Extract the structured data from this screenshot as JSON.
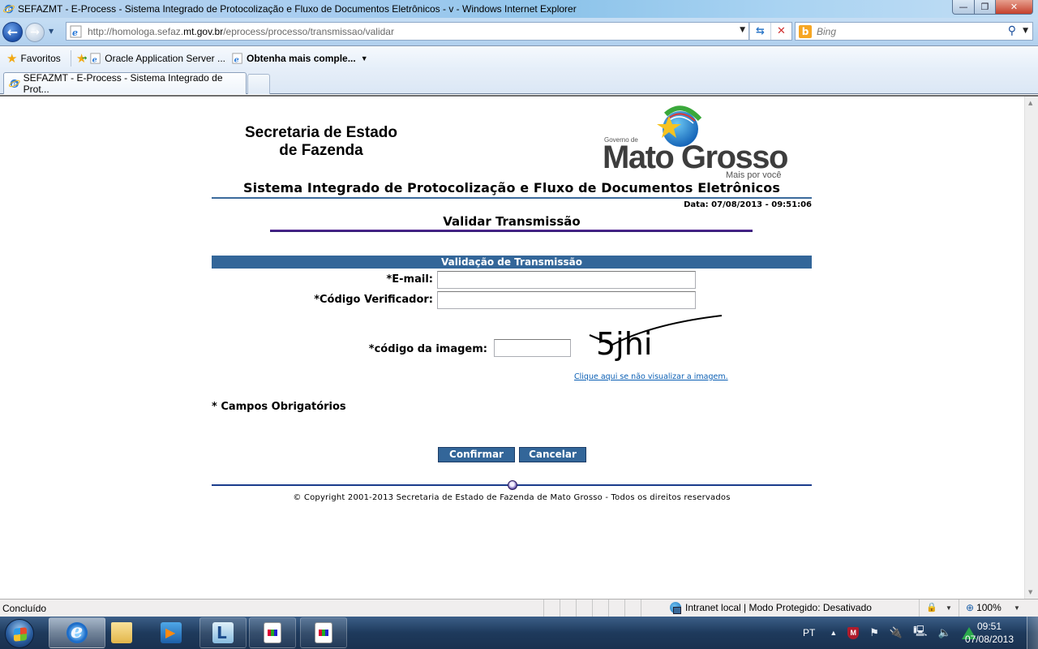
{
  "window": {
    "title": "SEFAZMT - E-Process - Sistema Integrado de Protocolização e Fluxo de Documentos Eletrônicos - v - Windows Internet Explorer",
    "minimize": "—",
    "maximize": "❐",
    "close": "✕"
  },
  "address_bar": {
    "url_prefix": "http://homologa.sefaz.",
    "url_domain": "mt.gov.br",
    "url_path": "/eprocess/processo/transmissao/validar",
    "dropdown": "▼",
    "refresh": "⇆",
    "stop": "✕"
  },
  "search": {
    "placeholder": "Bing",
    "provider_logo": "b",
    "search_glyph": "⚲",
    "dropdown": "▼"
  },
  "favorites_bar": {
    "favorites_label": "Favoritos",
    "items": [
      {
        "label": "Oracle Application Server ..."
      },
      {
        "label": "Obtenha mais comple..."
      }
    ],
    "dropdown": "▼"
  },
  "tabs": [
    {
      "label": "SEFAZMT - E-Process - Sistema Integrado de Prot...",
      "active": true
    }
  ],
  "header": {
    "org_line1": "Secretaria de Estado",
    "org_line2": "de Fazenda",
    "logo_gov": "Governo de",
    "logo_name": "Mato Grosso",
    "logo_slogan": "Mais por você",
    "system_title": "Sistema Integrado de Protocolização e Fluxo de Documentos Eletrônicos",
    "date": "Data: 07/08/2013 - 09:51:06"
  },
  "page": {
    "title": "Validar Transmissão",
    "section_title": "Validação de Transmissão"
  },
  "form": {
    "email_label": "*E-mail:",
    "email_value": "",
    "code_label": "*Código Verificador:",
    "code_value": "",
    "captcha_label": "*código da imagem:",
    "captcha_value": "",
    "captcha_text": "5jhi",
    "captcha_link": "Clique aqui se não visualizar a imagem.",
    "required_note": "* Campos Obrigatórios",
    "confirm_label": "Confirmar",
    "cancel_label": "Cancelar"
  },
  "footer": {
    "copyright": "© Copyright 2001-2013 Secretaria de Estado de Fazenda de Mato Grosso - Todos os direitos reservados"
  },
  "statusbar": {
    "status": "Concluído",
    "zone": "Intranet local | Modo Protegido: Desativado",
    "zoom": "100%",
    "dropdown": "▼"
  },
  "taskbar": {
    "language": "PT",
    "tray_expand": "▲",
    "time": "09:51",
    "date": "07/08/2013"
  }
}
